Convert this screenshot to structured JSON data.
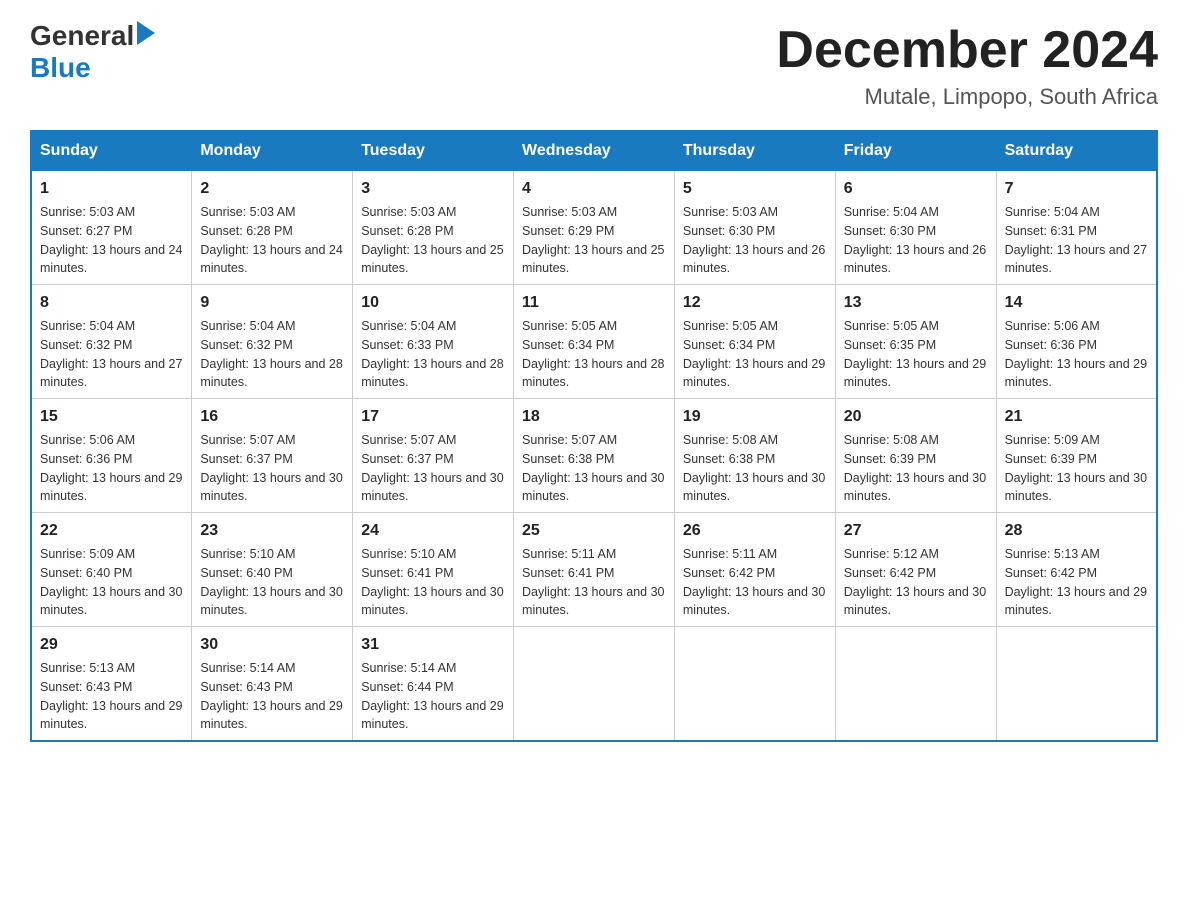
{
  "header": {
    "logo": {
      "general": "General",
      "blue": "Blue"
    },
    "month_title": "December 2024",
    "location": "Mutale, Limpopo, South Africa"
  },
  "days_of_week": [
    "Sunday",
    "Monday",
    "Tuesday",
    "Wednesday",
    "Thursday",
    "Friday",
    "Saturday"
  ],
  "weeks": [
    [
      {
        "day": "1",
        "sunrise": "5:03 AM",
        "sunset": "6:27 PM",
        "daylight": "13 hours and 24 minutes."
      },
      {
        "day": "2",
        "sunrise": "5:03 AM",
        "sunset": "6:28 PM",
        "daylight": "13 hours and 24 minutes."
      },
      {
        "day": "3",
        "sunrise": "5:03 AM",
        "sunset": "6:28 PM",
        "daylight": "13 hours and 25 minutes."
      },
      {
        "day": "4",
        "sunrise": "5:03 AM",
        "sunset": "6:29 PM",
        "daylight": "13 hours and 25 minutes."
      },
      {
        "day": "5",
        "sunrise": "5:03 AM",
        "sunset": "6:30 PM",
        "daylight": "13 hours and 26 minutes."
      },
      {
        "day": "6",
        "sunrise": "5:04 AM",
        "sunset": "6:30 PM",
        "daylight": "13 hours and 26 minutes."
      },
      {
        "day": "7",
        "sunrise": "5:04 AM",
        "sunset": "6:31 PM",
        "daylight": "13 hours and 27 minutes."
      }
    ],
    [
      {
        "day": "8",
        "sunrise": "5:04 AM",
        "sunset": "6:32 PM",
        "daylight": "13 hours and 27 minutes."
      },
      {
        "day": "9",
        "sunrise": "5:04 AM",
        "sunset": "6:32 PM",
        "daylight": "13 hours and 28 minutes."
      },
      {
        "day": "10",
        "sunrise": "5:04 AM",
        "sunset": "6:33 PM",
        "daylight": "13 hours and 28 minutes."
      },
      {
        "day": "11",
        "sunrise": "5:05 AM",
        "sunset": "6:34 PM",
        "daylight": "13 hours and 28 minutes."
      },
      {
        "day": "12",
        "sunrise": "5:05 AM",
        "sunset": "6:34 PM",
        "daylight": "13 hours and 29 minutes."
      },
      {
        "day": "13",
        "sunrise": "5:05 AM",
        "sunset": "6:35 PM",
        "daylight": "13 hours and 29 minutes."
      },
      {
        "day": "14",
        "sunrise": "5:06 AM",
        "sunset": "6:36 PM",
        "daylight": "13 hours and 29 minutes."
      }
    ],
    [
      {
        "day": "15",
        "sunrise": "5:06 AM",
        "sunset": "6:36 PM",
        "daylight": "13 hours and 29 minutes."
      },
      {
        "day": "16",
        "sunrise": "5:07 AM",
        "sunset": "6:37 PM",
        "daylight": "13 hours and 30 minutes."
      },
      {
        "day": "17",
        "sunrise": "5:07 AM",
        "sunset": "6:37 PM",
        "daylight": "13 hours and 30 minutes."
      },
      {
        "day": "18",
        "sunrise": "5:07 AM",
        "sunset": "6:38 PM",
        "daylight": "13 hours and 30 minutes."
      },
      {
        "day": "19",
        "sunrise": "5:08 AM",
        "sunset": "6:38 PM",
        "daylight": "13 hours and 30 minutes."
      },
      {
        "day": "20",
        "sunrise": "5:08 AM",
        "sunset": "6:39 PM",
        "daylight": "13 hours and 30 minutes."
      },
      {
        "day": "21",
        "sunrise": "5:09 AM",
        "sunset": "6:39 PM",
        "daylight": "13 hours and 30 minutes."
      }
    ],
    [
      {
        "day": "22",
        "sunrise": "5:09 AM",
        "sunset": "6:40 PM",
        "daylight": "13 hours and 30 minutes."
      },
      {
        "day": "23",
        "sunrise": "5:10 AM",
        "sunset": "6:40 PM",
        "daylight": "13 hours and 30 minutes."
      },
      {
        "day": "24",
        "sunrise": "5:10 AM",
        "sunset": "6:41 PM",
        "daylight": "13 hours and 30 minutes."
      },
      {
        "day": "25",
        "sunrise": "5:11 AM",
        "sunset": "6:41 PM",
        "daylight": "13 hours and 30 minutes."
      },
      {
        "day": "26",
        "sunrise": "5:11 AM",
        "sunset": "6:42 PM",
        "daylight": "13 hours and 30 minutes."
      },
      {
        "day": "27",
        "sunrise": "5:12 AM",
        "sunset": "6:42 PM",
        "daylight": "13 hours and 30 minutes."
      },
      {
        "day": "28",
        "sunrise": "5:13 AM",
        "sunset": "6:42 PM",
        "daylight": "13 hours and 29 minutes."
      }
    ],
    [
      {
        "day": "29",
        "sunrise": "5:13 AM",
        "sunset": "6:43 PM",
        "daylight": "13 hours and 29 minutes."
      },
      {
        "day": "30",
        "sunrise": "5:14 AM",
        "sunset": "6:43 PM",
        "daylight": "13 hours and 29 minutes."
      },
      {
        "day": "31",
        "sunrise": "5:14 AM",
        "sunset": "6:44 PM",
        "daylight": "13 hours and 29 minutes."
      },
      null,
      null,
      null,
      null
    ]
  ],
  "labels": {
    "sunrise": "Sunrise: ",
    "sunset": "Sunset: ",
    "daylight": "Daylight: "
  }
}
